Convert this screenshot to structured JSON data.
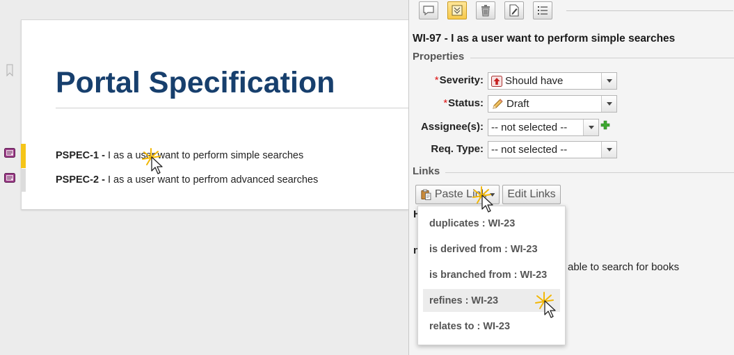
{
  "document": {
    "title": "Portal Specification",
    "requirements": [
      {
        "id": "PSPEC-1 -",
        "text": " I as a user want to perform simple searches"
      },
      {
        "id": "PSPEC-2 -",
        "text": " I as a user want to perfrom advanced searches"
      }
    ]
  },
  "sidebar": {
    "toolbar": {
      "buttons": [
        {
          "icon": "comment-icon",
          "active": false
        },
        {
          "icon": "expand-icon",
          "active": true
        },
        {
          "icon": "trash-icon",
          "active": false
        },
        {
          "icon": "document-edit-icon",
          "active": false
        },
        {
          "icon": "list-icon",
          "active": false
        }
      ]
    },
    "work_item_title": "WI-97 - I as a user want to perform simple searches",
    "properties": {
      "heading": "Properties",
      "fields": [
        {
          "label": "Severity:",
          "required": "*",
          "value": "Should have",
          "icon": "severity-up-icon"
        },
        {
          "label": "Status:",
          "required": "*",
          "value": "Draft",
          "icon": "pencil-icon"
        },
        {
          "label": "Assignee(s):",
          "required": "",
          "value": "-- not selected --"
        },
        {
          "label": "Req. Type:",
          "required": "",
          "value": "-- not selected --"
        }
      ]
    },
    "links": {
      "heading": "Links",
      "paste_link": "Paste Link",
      "edit_links": "Edit Links",
      "menu": [
        "duplicates : WI-23",
        "is derived from : WI-23",
        "is branched from : WI-23",
        "refines : WI-23",
        "relates to : WI-23"
      ],
      "highlighted_index": 3
    },
    "background_text": {
      "h_fragment": "H",
      "n_fragment": "n",
      "description_fragment": "able to search for books"
    }
  },
  "colors": {
    "title_blue": "#173f6d",
    "yellow_marker": "#f5c518",
    "required_red": "#dd1111",
    "add_green": "#3da830"
  }
}
